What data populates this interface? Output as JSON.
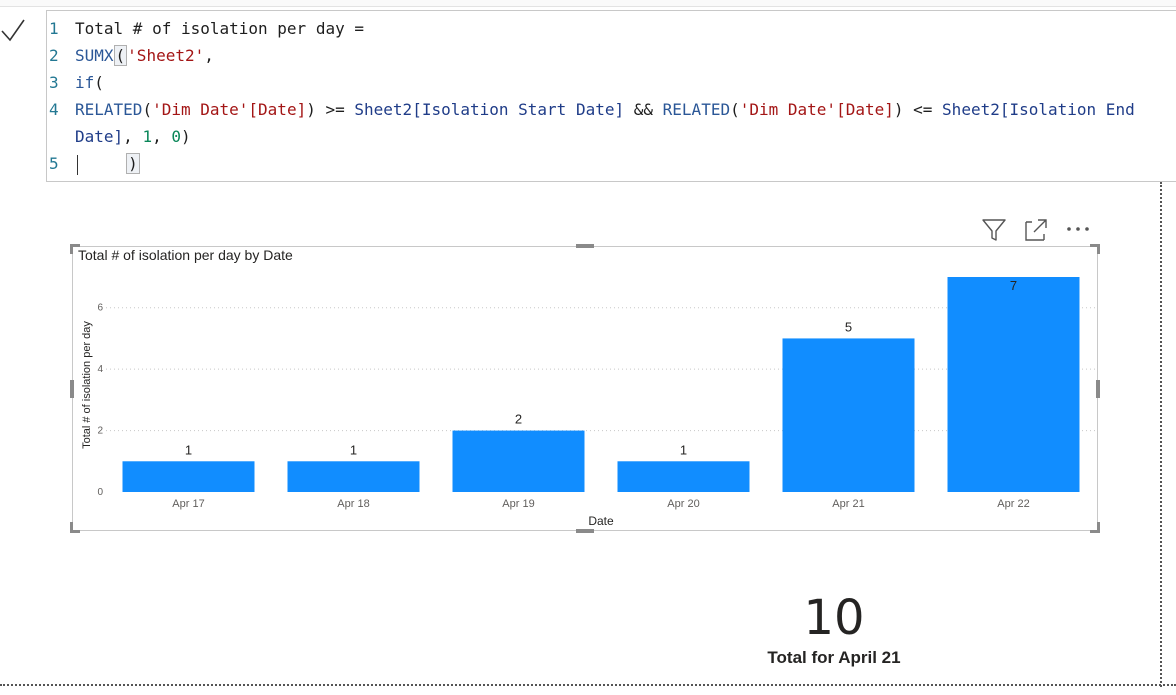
{
  "formula": {
    "line_numbers": [
      "1",
      "2",
      "3",
      "4",
      "5"
    ],
    "line1": "Total # of isolation per day =",
    "line2": {
      "fn": "SUMX",
      "open": "(",
      "table": "'Sheet2'",
      "tail": ","
    },
    "line3": {
      "fn": "if",
      "tail": "("
    },
    "line4": {
      "fn1": "RELATED",
      "p1": "(",
      "arg1": "'Dim Date'[Date]",
      "p2": ")",
      "op1": ">=",
      "col1": "Sheet2[Isolation Start Date]",
      "op2": "&&",
      "fn2": "RELATED",
      "p3": "(",
      "arg2": "'Dim Date'[Date]",
      "p4": ")",
      "op3": "<=",
      "col2a": "Sheet2[Isolation End",
      "col2b": "Date]",
      "comma1": ",",
      "n1": "1",
      "comma2": ",",
      "n0": "0",
      "p5": ")"
    },
    "line5": ")"
  },
  "visual": {
    "title": "Total # of isolation per day by Date",
    "header_icons": [
      "filter-icon",
      "focus-mode-icon",
      "more-options-icon"
    ]
  },
  "chart_data": {
    "type": "bar",
    "title": "Total # of isolation per day by Date",
    "xlabel": "Date",
    "ylabel": "Total # of isolation per day",
    "categories": [
      "Apr 17",
      "Apr 18",
      "Apr 19",
      "Apr 20",
      "Apr 21",
      "Apr 22"
    ],
    "values": [
      1,
      1,
      2,
      1,
      5,
      7
    ],
    "data_labels": [
      "1",
      "1",
      "2",
      "1",
      "5",
      "7"
    ],
    "yticks": [
      "0",
      "2",
      "4",
      "6"
    ],
    "ylim": [
      0,
      7
    ],
    "grid": true,
    "color": "#118DFF"
  },
  "card": {
    "value": "10",
    "label": "Total for April 21"
  },
  "colors": {
    "bar": "#118DFF",
    "line_number": "#237893",
    "keyword": "#2b5797",
    "string": "#a31515",
    "number": "#098658"
  }
}
